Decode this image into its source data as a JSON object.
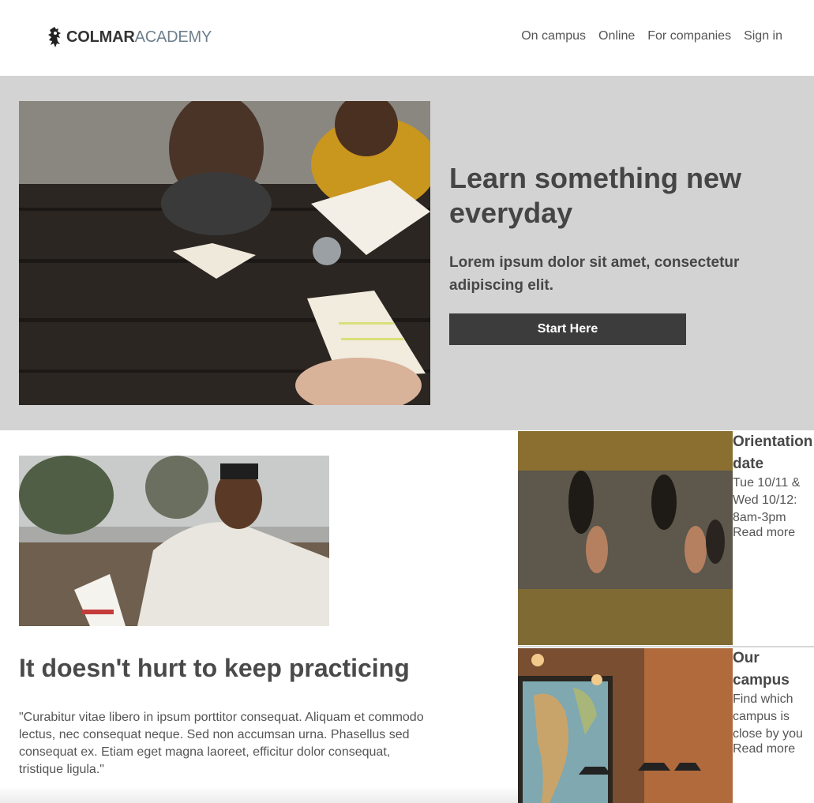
{
  "brand": {
    "name_part1": "COLMAR",
    "name_part2": "ACADEMY",
    "icon": "lion-crest-icon"
  },
  "nav": {
    "items": [
      {
        "label": "On campus"
      },
      {
        "label": "Online"
      },
      {
        "label": "For companies"
      },
      {
        "label": "Sign in"
      }
    ]
  },
  "hero": {
    "title": "Learn something new everyday",
    "subtitle": "Lorem ipsum dolor sit amet, consectetur adipiscing elit.",
    "button_label": "Start Here"
  },
  "practice": {
    "title": "It doesn't hurt to keep practicing",
    "text": "\"Curabitur vitae libero in ipsum porttitor consequat. Aliquam et commodo lectus, nec consequat neque. Sed non accumsan urna. Phasellus sed consequat ex. Etiam eget magna laoreet, efficitur dolor consequat, tristique ligula.\""
  },
  "cards": [
    {
      "title": "Orientation date",
      "text": "Tue 10/11 & Wed 10/12: 8am-3pm",
      "link": "Read more"
    },
    {
      "title": "Our campus",
      "text": "Find which campus is close by you",
      "link": "Read more"
    }
  ],
  "colors": {
    "hero_bg": "#d3d3d3",
    "button_bg": "#3c3c3c",
    "brand_secondary": "#6e7f8d"
  }
}
